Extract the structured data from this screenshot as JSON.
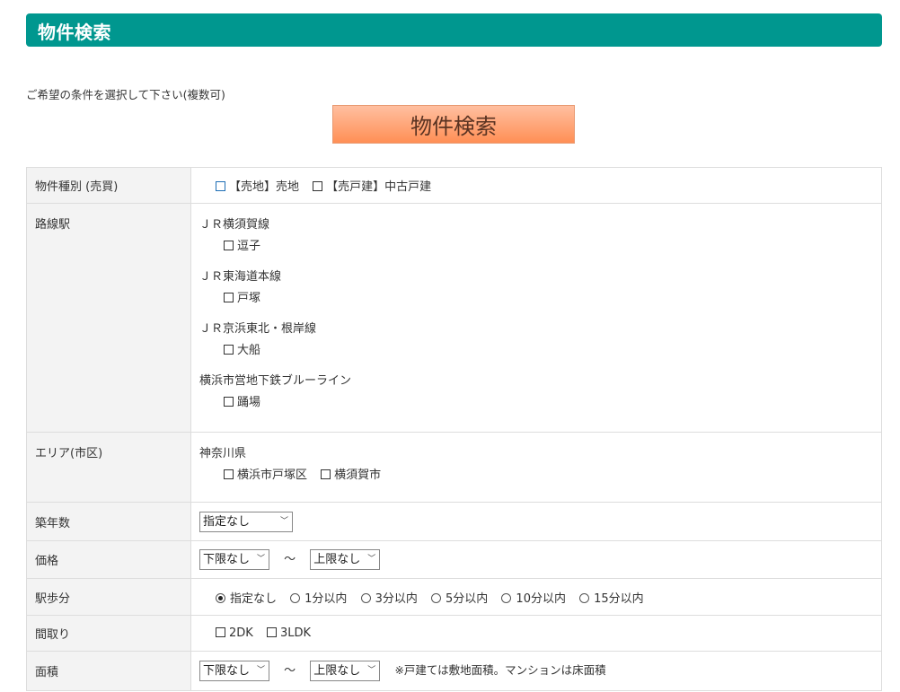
{
  "header": {
    "title": "物件検索"
  },
  "instruction": "ご希望の条件を選択して下さい(複数可)",
  "search_button": "物件検索",
  "rows": {
    "type": {
      "label": "物件種別 (売買)",
      "options": [
        "【売地】売地",
        "【売戸建】中古戸建"
      ]
    },
    "route": {
      "label": "路線駅",
      "lines": [
        {
          "name": "ＪＲ横須賀線",
          "station": "逗子"
        },
        {
          "name": "ＪＲ東海道本線",
          "station": "戸塚"
        },
        {
          "name": "ＪＲ京浜東北・根岸線",
          "station": "大船"
        },
        {
          "name": "横浜市営地下鉄ブルーライン",
          "station": "踊場"
        }
      ]
    },
    "area": {
      "label": "エリア(市区)",
      "prefecture": "神奈川県",
      "options": [
        "横浜市戸塚区",
        "横須賀市"
      ]
    },
    "age": {
      "label": "築年数",
      "value": "指定なし"
    },
    "price": {
      "label": "価格",
      "min": "下限なし",
      "separator": "～",
      "max": "上限なし"
    },
    "walk": {
      "label": "駅歩分",
      "options": [
        "指定なし",
        "1分以内",
        "3分以内",
        "5分以内",
        "10分以内",
        "15分以内"
      ],
      "selected": "指定なし"
    },
    "layout": {
      "label": "間取り",
      "options": [
        "2DK",
        "3LDK"
      ]
    },
    "size": {
      "label": "面積",
      "min": "下限なし",
      "separator": "～",
      "max": "上限なし",
      "note": "※戸建ては敷地面積。マンションは床面積"
    }
  },
  "colors": {
    "header_bg": "#00978f",
    "button_top": "#ffbfa0",
    "button_bottom": "#ff8f55"
  }
}
